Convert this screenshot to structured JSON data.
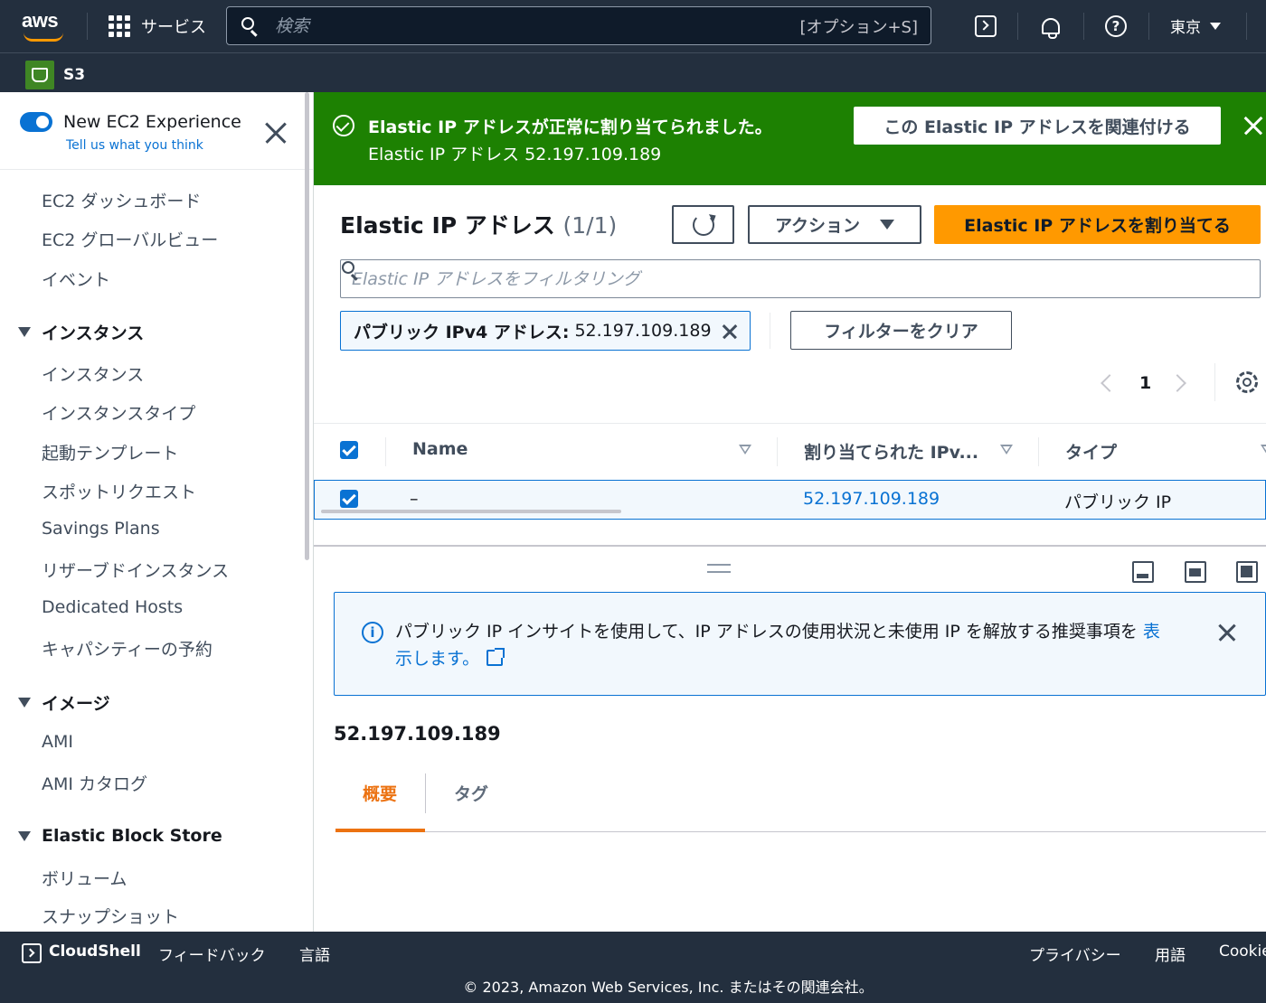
{
  "topnav": {
    "logo": "aws",
    "services_label": "サービス",
    "search_placeholder": "検索",
    "search_shortcut": "[オプション+S]",
    "region_label": "東京",
    "icons": [
      "cloudshell-icon",
      "bell-icon",
      "help-icon"
    ]
  },
  "favorites": {
    "s3_label": "S3"
  },
  "sidebar": {
    "experience_title": "New EC2 Experience",
    "experience_link": "Tell us what you think",
    "items": [
      {
        "type": "item",
        "label": "EC2 ダッシュボード"
      },
      {
        "type": "item",
        "label": "EC2 グローバルビュー"
      },
      {
        "type": "item",
        "label": "イベント"
      },
      {
        "type": "section",
        "label": "インスタンス"
      },
      {
        "type": "item",
        "label": "インスタンス"
      },
      {
        "type": "item",
        "label": "インスタンスタイプ"
      },
      {
        "type": "item",
        "label": "起動テンプレート"
      },
      {
        "type": "item",
        "label": "スポットリクエスト"
      },
      {
        "type": "item",
        "label": "Savings Plans"
      },
      {
        "type": "item",
        "label": "リザーブドインスタンス"
      },
      {
        "type": "item",
        "label": "Dedicated Hosts"
      },
      {
        "type": "item",
        "label": "キャパシティーの予約"
      },
      {
        "type": "section",
        "label": "イメージ"
      },
      {
        "type": "item",
        "label": "AMI"
      },
      {
        "type": "item",
        "label": "AMI カタログ"
      },
      {
        "type": "section",
        "label": "Elastic Block Store"
      },
      {
        "type": "item",
        "label": "ボリューム"
      },
      {
        "type": "item",
        "label": "スナップショット"
      }
    ]
  },
  "flash": {
    "title": "Elastic IP アドレスが正常に割り当てられました。",
    "subtitle": "Elastic IP アドレス 52.197.109.189",
    "action_label": "この Elastic IP アドレスを関連付ける",
    "color": "#1d8102"
  },
  "main": {
    "title": "Elastic IP アドレス",
    "count": "(1/1)",
    "actions_label": "アクション",
    "allocate_label": "Elastic IP アドレスを割り当てる",
    "filter_placeholder": "Elastic IP アドレスをフィルタリング",
    "token_key": "パブリック IPv4 アドレス:",
    "token_value": "52.197.109.189",
    "clear_filters_label": "フィルターをクリア",
    "page_number": "1",
    "accent_color": "#ff9900"
  },
  "table": {
    "columns": [
      "Name",
      "割り当てられた IPv...",
      "タイプ"
    ],
    "rows": [
      {
        "selected": true,
        "name": "–",
        "ipv4": "52.197.109.189",
        "type": "パブリック IP"
      }
    ]
  },
  "split": {
    "info_text": "パブリック IP インサイトを使用して、IP アドレスの使用状況と未使用 IP を解放する推奨事項を ",
    "info_link_part1": "表",
    "info_link_part2": "示します。",
    "detail_title": "52.197.109.189",
    "tabs": [
      {
        "label": "概要",
        "active": true
      },
      {
        "label": "タグ",
        "active": false
      }
    ]
  },
  "footer": {
    "cloudshell_label": "CloudShell",
    "feedback_label": "フィードバック",
    "language_label": "言語",
    "privacy_label": "プライバシー",
    "terms_label": "用語",
    "cookies_label": "Cookie",
    "copyright": "© 2023, Amazon Web Services, Inc. またはその関連会社。"
  }
}
